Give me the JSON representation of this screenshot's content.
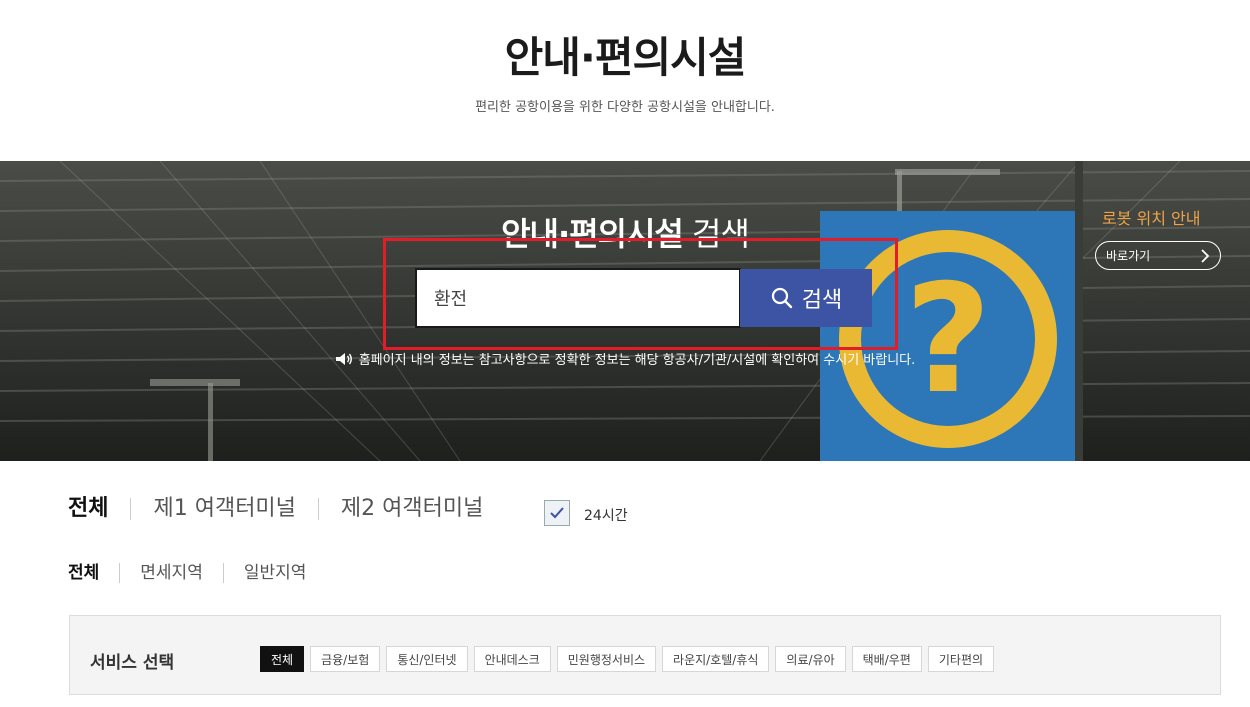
{
  "header": {
    "title": "안내·편의시설",
    "subtitle": "편리한 공항이용을 위한 다양한 공항시설을 안내합니다."
  },
  "banner": {
    "title_strong": "안내·편의시설",
    "title_light": " 검색",
    "search": {
      "value": "환전",
      "button_label": "검색"
    },
    "notice": "홈페이지 내의 정보는 참고사항으로 정확한 정보는 해당 항공사/기관/시설에 확인하여 수시기 바랍니다.",
    "robot": {
      "title": "로봇 위치 안내",
      "link_label": "바로가기"
    }
  },
  "terminal_tabs": [
    {
      "label": "전체",
      "active": true
    },
    {
      "label": "제1 여객터미널",
      "active": false
    },
    {
      "label": "제2 여객터미널",
      "active": false
    }
  ],
  "open24": {
    "label": "24시간",
    "checked": true
  },
  "zone_tabs": [
    {
      "label": "전체",
      "active": true
    },
    {
      "label": "면세지역",
      "active": false
    },
    {
      "label": "일반지역",
      "active": false
    }
  ],
  "service": {
    "label": "서비스 선택",
    "chips": [
      {
        "label": "전체",
        "active": true
      },
      {
        "label": "금융/보험",
        "active": false
      },
      {
        "label": "통신/인터넷",
        "active": false
      },
      {
        "label": "안내데스크",
        "active": false
      },
      {
        "label": "민원행정서비스",
        "active": false
      },
      {
        "label": "라운지/호텔/휴식",
        "active": false
      },
      {
        "label": "의료/유아",
        "active": false
      },
      {
        "label": "택배/우편",
        "active": false
      },
      {
        "label": "기타편의",
        "active": false
      }
    ]
  },
  "colors": {
    "highlight": "#e11d2a",
    "search_button": "#3d54a5",
    "robot_title": "#f0a346"
  }
}
